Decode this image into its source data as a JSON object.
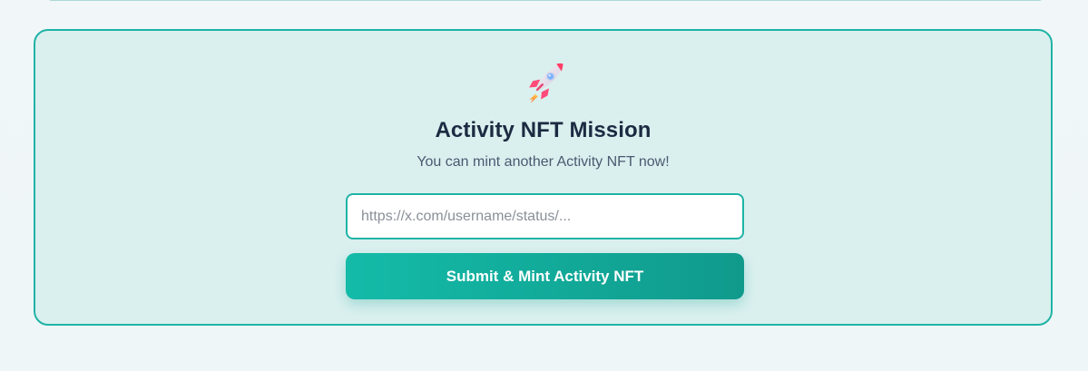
{
  "mission": {
    "icon": "rocket-icon",
    "title": "Activity NFT Mission",
    "subtitle": "You can mint another Activity NFT now!",
    "tweet_url_input": {
      "value": "",
      "placeholder": "https://x.com/username/status/..."
    },
    "submit_label": "Submit & Mint Activity NFT"
  },
  "colors": {
    "accent": "#1fb3a6",
    "card_background": "#daf0ef",
    "title_text": "#1c2b42",
    "subtitle_text": "#4a5a70",
    "button_gradient_start": "#14bba8",
    "button_gradient_end": "#109a8c"
  }
}
